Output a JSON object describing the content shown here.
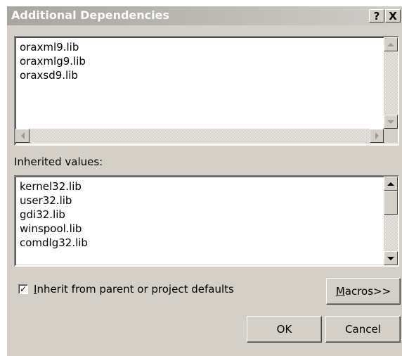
{
  "window": {
    "title": "Additional Dependencies",
    "help_label": "?",
    "close_label": "X"
  },
  "dependencies": {
    "items": [
      "oraxml9.lib",
      "oraxmlg9.lib",
      "oraxsd9.lib"
    ]
  },
  "inherited": {
    "label": "Inherited values:",
    "items": [
      "kernel32.lib",
      "user32.lib",
      "gdi32.lib",
      "winspool.lib",
      "comdlg32.lib"
    ]
  },
  "inherit_checkbox": {
    "checked": true,
    "check_mark": "✓",
    "mnemonic": "I",
    "label_rest": "nherit from parent or project defaults"
  },
  "buttons": {
    "macros_mnemonic": "M",
    "macros_rest": "acros>>",
    "ok": "OK",
    "cancel": "Cancel"
  }
}
